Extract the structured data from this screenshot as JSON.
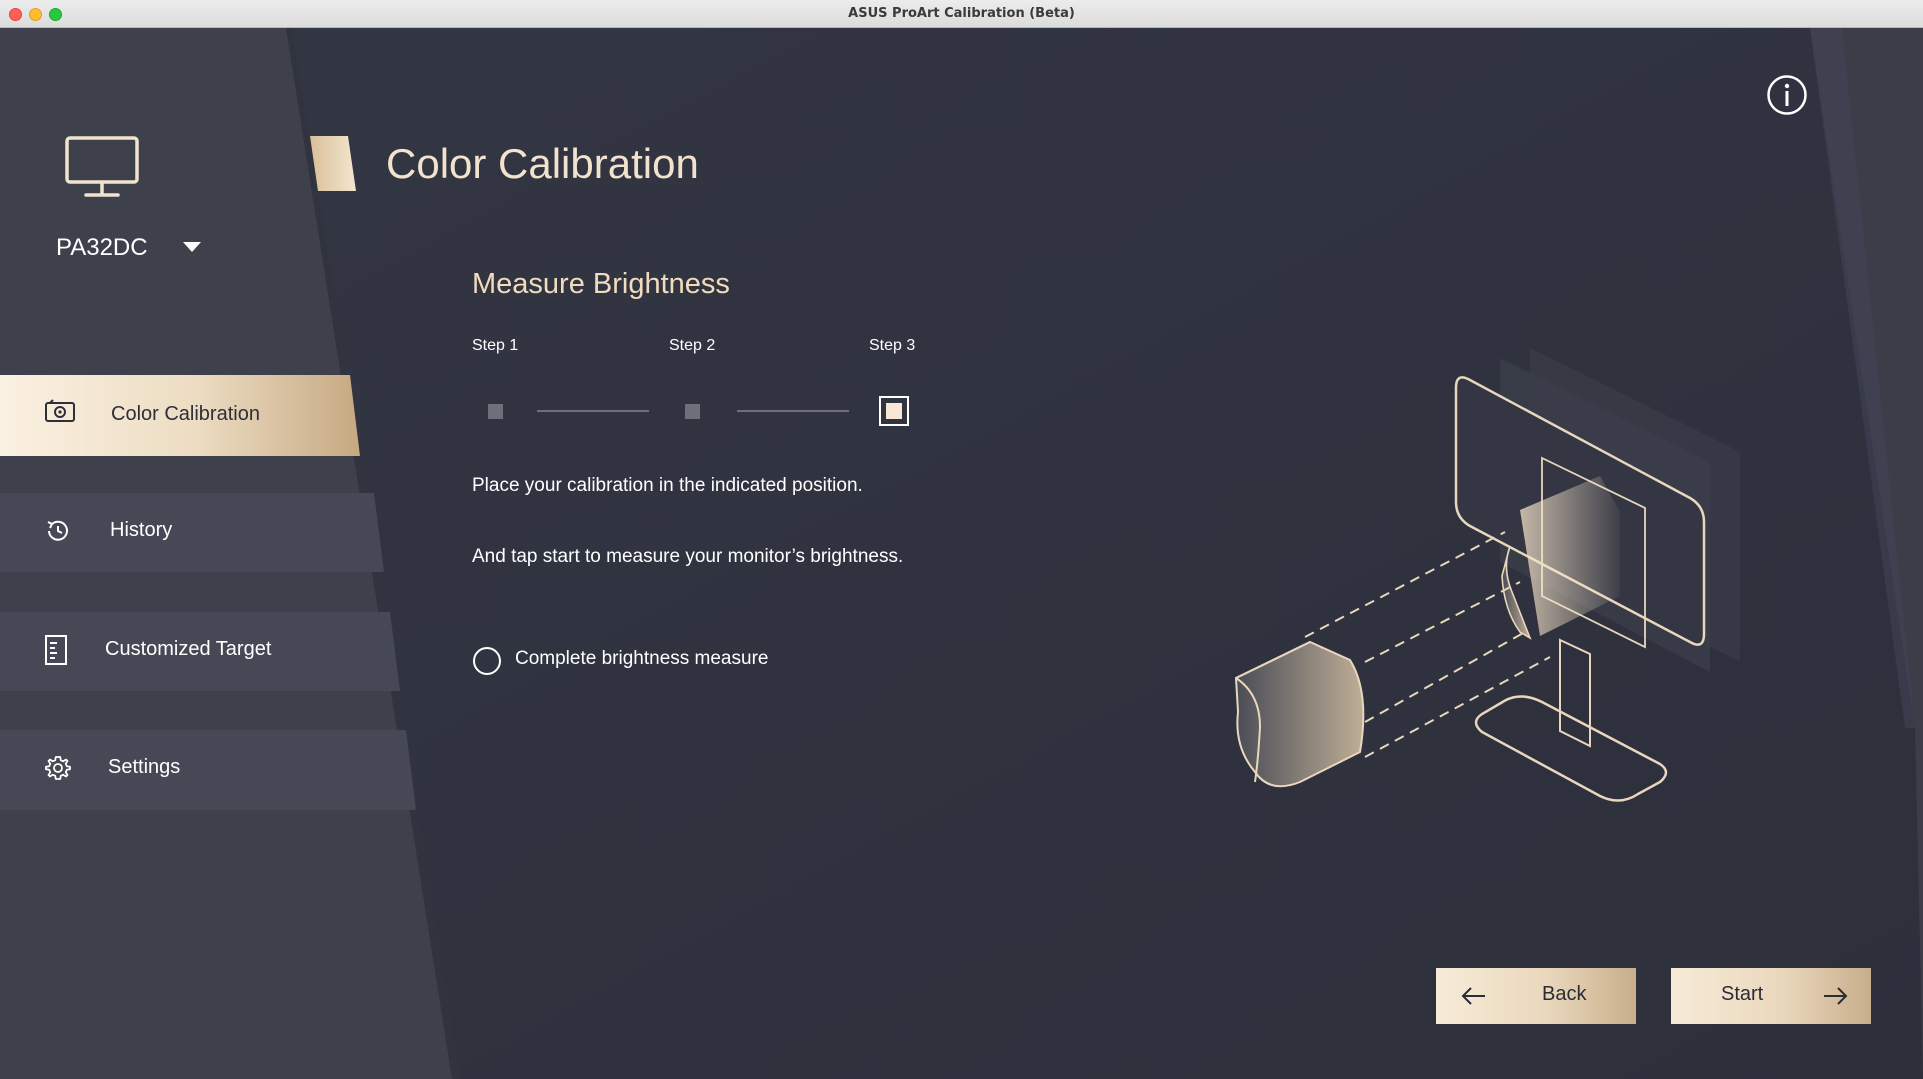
{
  "window": {
    "title": "ASUS ProArt Calibration (Beta)"
  },
  "device": {
    "name": "PA32DC"
  },
  "sidebar": {
    "items": [
      {
        "label": "Color Calibration",
        "icon": "camera-icon",
        "active": true
      },
      {
        "label": "History",
        "icon": "history-icon",
        "active": false
      },
      {
        "label": "Customized Target",
        "icon": "document-icon",
        "active": false
      },
      {
        "label": "Settings",
        "icon": "gear-icon",
        "active": false
      }
    ]
  },
  "main": {
    "title": "Color Calibration",
    "section_title": "Measure Brightness",
    "steps": [
      {
        "label": "Step 1"
      },
      {
        "label": "Step 2"
      },
      {
        "label": "Step 3"
      }
    ],
    "current_step": 3,
    "instruction_1": "Place your calibration in the indicated position.",
    "instruction_2": "And tap start to measure your monitor’s brightness.",
    "checkbox_label": "Complete brightness measure",
    "checkbox_checked": false
  },
  "buttons": {
    "back": "Back",
    "start": "Start"
  },
  "colors": {
    "accent": "#f1dcbd",
    "sidebar": "#3f414d",
    "background": "#2e313d"
  }
}
